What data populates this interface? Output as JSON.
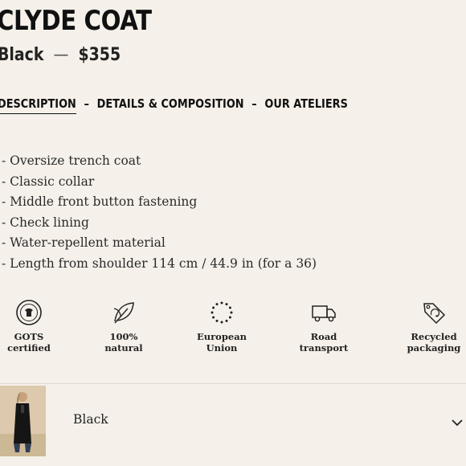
{
  "product": {
    "title": "CLYDE COAT",
    "color": "Black",
    "price": "$355"
  },
  "tabs": [
    {
      "label": "DESCRIPTION",
      "active": true
    },
    {
      "label": "DETAILS & COMPOSITION",
      "active": false
    },
    {
      "label": "OUR ATELIERS",
      "active": false
    }
  ],
  "tab_separator": "–",
  "subline_separator": "—",
  "features": [
    "Oversize trench coat",
    "Classic collar",
    "Middle front button fastening",
    "Check lining",
    "Water-repellent material",
    "Length from shoulder 114 cm / 44.9 in (for a 36)"
  ],
  "badges": [
    {
      "icon": "gots-icon",
      "line1": "GOTS",
      "line2": "certified"
    },
    {
      "icon": "leaf-icon",
      "line1": "100%",
      "line2": "natural"
    },
    {
      "icon": "eu-stars-icon",
      "line1": "European",
      "line2": "Union"
    },
    {
      "icon": "truck-icon",
      "line1": "Road",
      "line2": "transport"
    },
    {
      "icon": "recycle-tag-icon",
      "line1": "Recycled",
      "line2": "packaging"
    }
  ],
  "variant": {
    "label": "Black",
    "icon": "chevron-down-icon"
  }
}
